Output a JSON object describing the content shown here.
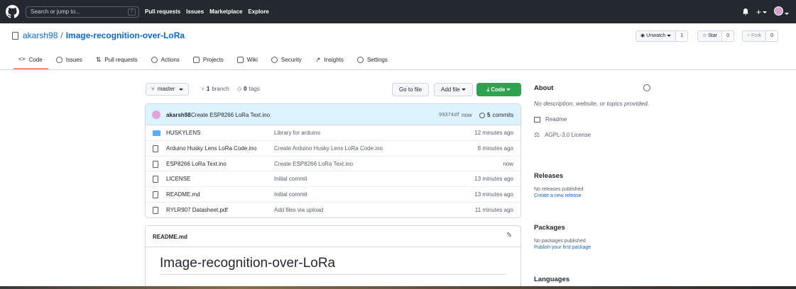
{
  "topbar": {
    "search_placeholder": "Search or jump to...",
    "search_shortcut": "/",
    "nav": [
      "Pull requests",
      "Issues",
      "Marketplace",
      "Explore"
    ]
  },
  "repo": {
    "owner": "akarsh98",
    "separator": "/",
    "name": "Image-recognition-over-LoRa",
    "watch_label": "Unwatch",
    "watch_count": "1",
    "star_label": "Star",
    "star_count": "0",
    "fork_label": "Fork",
    "fork_count": "0"
  },
  "tabs": [
    {
      "label": "Code",
      "icon": "code-icon"
    },
    {
      "label": "Issues",
      "icon": "issue-icon"
    },
    {
      "label": "Pull requests",
      "icon": "pull-request-icon"
    },
    {
      "label": "Actions",
      "icon": "play-icon"
    },
    {
      "label": "Projects",
      "icon": "project-icon"
    },
    {
      "label": "Wiki",
      "icon": "book-icon"
    },
    {
      "label": "Security",
      "icon": "shield-icon"
    },
    {
      "label": "Insights",
      "icon": "graph-icon"
    },
    {
      "label": "Settings",
      "icon": "gear-icon"
    }
  ],
  "toolbar": {
    "branch": "master",
    "branch_count": "1",
    "branch_word": "branch",
    "tag_count": "0",
    "tag_word": "tags",
    "goto_file": "Go to file",
    "add_file": "Add file",
    "code": "Code"
  },
  "commit": {
    "author": "akarsh98",
    "message": "Create ESP8266 LoRa Text.ino",
    "hash": "99374df",
    "time": "now",
    "count": "5",
    "count_word": "commits"
  },
  "files": [
    {
      "name": "HUSKYLENS",
      "type": "dir",
      "message": "Library for arduino",
      "age": "12 minutes ago"
    },
    {
      "name": "Arduino Husky Lens LoRa Code.ino",
      "type": "file",
      "message": "Create Arduino Husky Lens LoRa Code.ino",
      "age": "8 minutes ago"
    },
    {
      "name": "ESP8266 LoRa Text.ino",
      "type": "file",
      "message": "Create ESP8266 LoRa Text.ino",
      "age": "now"
    },
    {
      "name": "LICENSE",
      "type": "file",
      "message": "Initial commit",
      "age": "13 minutes ago"
    },
    {
      "name": "README.md",
      "type": "file",
      "message": "Initial commit",
      "age": "13 minutes ago"
    },
    {
      "name": "RYLR907 Datasheet.pdf",
      "type": "file",
      "message": "Add files via upload",
      "age": "11 minutes ago"
    }
  ],
  "readme": {
    "filename": "README.md",
    "title": "Image-recognition-over-LoRa"
  },
  "sidebar": {
    "about_title": "About",
    "description": "No description, website, or topics provided.",
    "readme_link": "Readme",
    "license": "AGPL-3.0 License",
    "releases_title": "Releases",
    "releases_text": "No releases published",
    "releases_link": "Create a new release",
    "packages_title": "Packages",
    "packages_text": "No packages published",
    "packages_link": "Publish your first package",
    "languages_title": "Languages"
  }
}
